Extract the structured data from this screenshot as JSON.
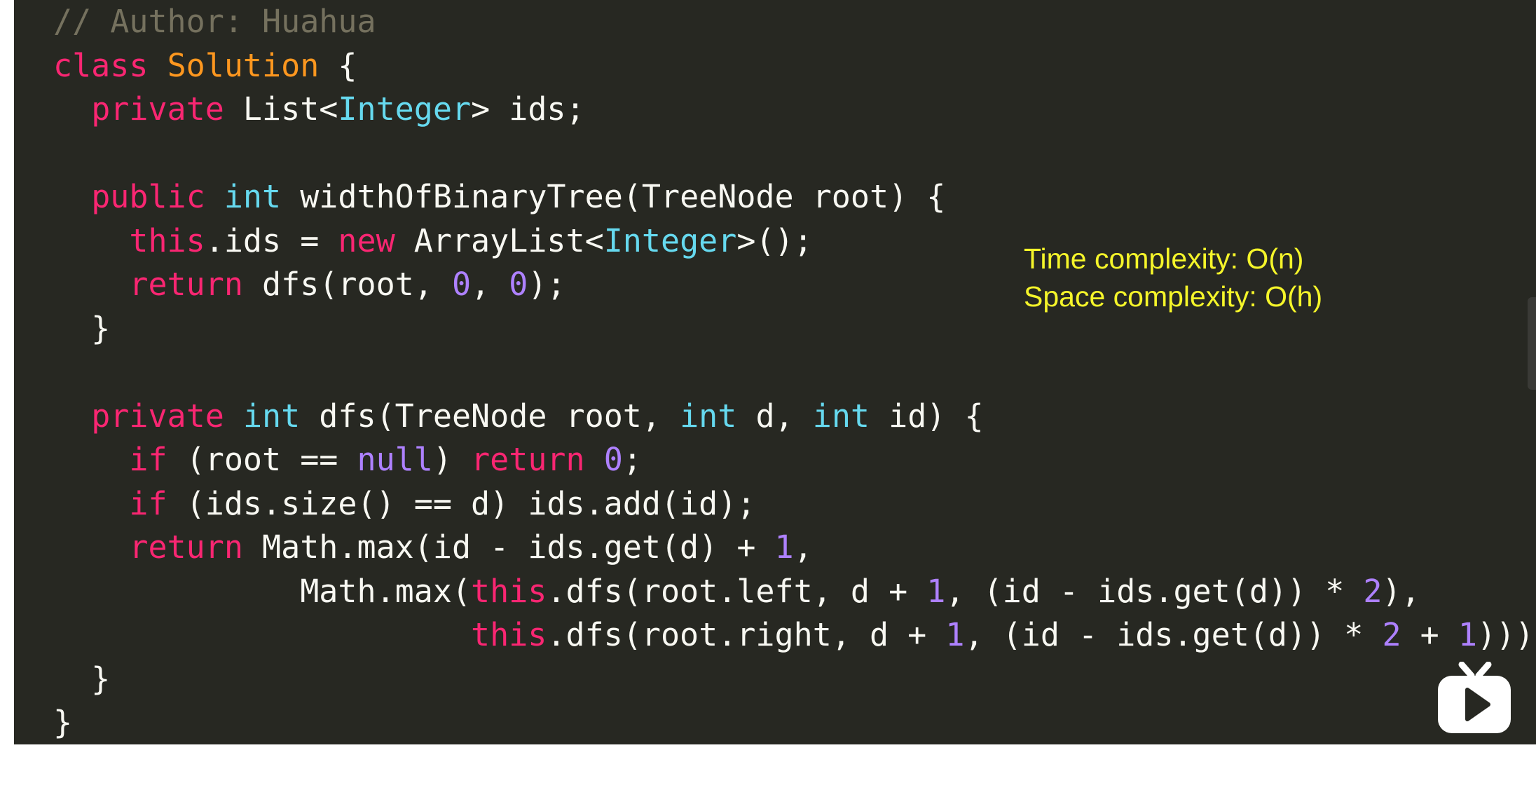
{
  "code": {
    "lines": [
      [
        {
          "t": "// Author: Huahua",
          "c": "cm"
        }
      ],
      [
        {
          "t": "class",
          "c": "kw"
        },
        {
          "t": " "
        },
        {
          "t": "Solution",
          "c": "cn"
        },
        {
          "t": " {"
        }
      ],
      [
        {
          "t": "  "
        },
        {
          "t": "private",
          "c": "kw"
        },
        {
          "t": " List<"
        },
        {
          "t": "Integer",
          "c": "ty"
        },
        {
          "t": "> ids;"
        }
      ],
      [],
      [
        {
          "t": "  "
        },
        {
          "t": "public",
          "c": "kw"
        },
        {
          "t": " "
        },
        {
          "t": "int",
          "c": "ty"
        },
        {
          "t": " widthOfBinaryTree(TreeNode root) {"
        }
      ],
      [
        {
          "t": "    "
        },
        {
          "t": "this",
          "c": "kw"
        },
        {
          "t": ".ids = "
        },
        {
          "t": "new",
          "c": "kw"
        },
        {
          "t": " ArrayList<"
        },
        {
          "t": "Integer",
          "c": "ty"
        },
        {
          "t": ">();"
        }
      ],
      [
        {
          "t": "    "
        },
        {
          "t": "return",
          "c": "kw"
        },
        {
          "t": " dfs(root, "
        },
        {
          "t": "0",
          "c": "nu"
        },
        {
          "t": ", "
        },
        {
          "t": "0",
          "c": "nu"
        },
        {
          "t": ");"
        }
      ],
      [
        {
          "t": "  }"
        }
      ],
      [],
      [
        {
          "t": "  "
        },
        {
          "t": "private",
          "c": "kw"
        },
        {
          "t": " "
        },
        {
          "t": "int",
          "c": "ty"
        },
        {
          "t": " dfs(TreeNode root, "
        },
        {
          "t": "int",
          "c": "ty"
        },
        {
          "t": " d, "
        },
        {
          "t": "int",
          "c": "ty"
        },
        {
          "t": " id) {"
        }
      ],
      [
        {
          "t": "    "
        },
        {
          "t": "if",
          "c": "kw"
        },
        {
          "t": " (root == "
        },
        {
          "t": "null",
          "c": "nu"
        },
        {
          "t": ") "
        },
        {
          "t": "return",
          "c": "kw"
        },
        {
          "t": " "
        },
        {
          "t": "0",
          "c": "nu"
        },
        {
          "t": ";"
        }
      ],
      [
        {
          "t": "    "
        },
        {
          "t": "if",
          "c": "kw"
        },
        {
          "t": " (ids.size() == d) ids.add(id);"
        }
      ],
      [
        {
          "t": "    "
        },
        {
          "t": "return",
          "c": "kw"
        },
        {
          "t": " Math.max(id - ids.get(d) + "
        },
        {
          "t": "1",
          "c": "nu"
        },
        {
          "t": ","
        }
      ],
      [
        {
          "t": "             Math.max("
        },
        {
          "t": "this",
          "c": "kw"
        },
        {
          "t": ".dfs(root.left, d + "
        },
        {
          "t": "1",
          "c": "nu"
        },
        {
          "t": ", (id - ids.get(d)) * "
        },
        {
          "t": "2",
          "c": "nu"
        },
        {
          "t": "),"
        }
      ],
      [
        {
          "t": "                      "
        },
        {
          "t": "this",
          "c": "kw"
        },
        {
          "t": ".dfs(root.right, d + "
        },
        {
          "t": "1",
          "c": "nu"
        },
        {
          "t": ", (id - ids.get(d)) * "
        },
        {
          "t": "2",
          "c": "nu"
        },
        {
          "t": " + "
        },
        {
          "t": "1",
          "c": "nu"
        },
        {
          "t": ")));"
        }
      ],
      [
        {
          "t": "  }"
        }
      ],
      [
        {
          "t": "}"
        }
      ]
    ]
  },
  "complexity": {
    "time": "Time complexity: O(n)",
    "space": "Space complexity: O(h)"
  },
  "colors": {
    "background": "#272822",
    "keyword": "#f92672",
    "type": "#66d9ef",
    "class_name": "#fd971f",
    "number": "#ae81ff",
    "comment": "#75715e",
    "annotation": "#f5f52a"
  },
  "icons": {
    "video_logo": "bilibili-tv-icon"
  }
}
